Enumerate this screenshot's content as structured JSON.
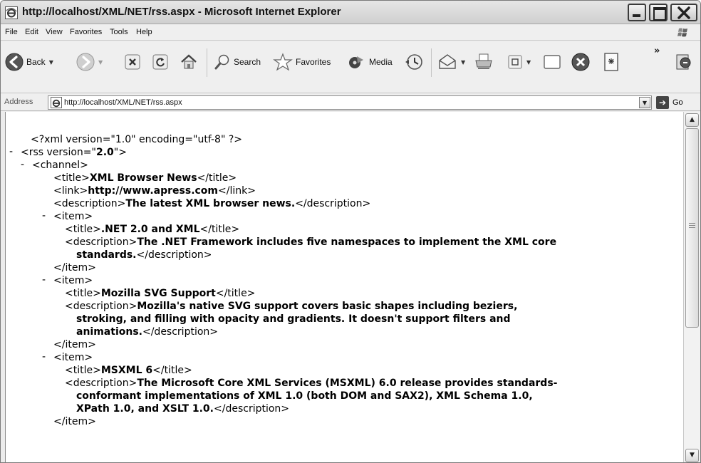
{
  "window": {
    "title": "http://localhost/XML/NET/rss.aspx - Microsoft Internet Explorer"
  },
  "menu": [
    "File",
    "Edit",
    "View",
    "Favorites",
    "Tools",
    "Help"
  ],
  "toolbar": {
    "back_label": "Back",
    "search_label": "Search",
    "favorites_label": "Favorites",
    "media_label": "Media",
    "more": "»"
  },
  "address": {
    "label": "Address",
    "url": "http://localhost/XML/NET/rss.aspx",
    "go_label": "Go"
  },
  "xml": {
    "declaration": "<?xml version=\"1.0\" encoding=\"utf-8\" ?>",
    "rss_open": "<rss version=\"",
    "rss_version": "2.0",
    "rss_close": "\">",
    "channel_open": "<channel>",
    "channel_title_open": "<title>",
    "channel_title": "XML Browser News",
    "channel_title_close": "</title>",
    "link_open": "<link>",
    "link": "http://www.apress.com",
    "link_close": "</link>",
    "desc_open": "<description>",
    "channel_description": "The latest XML browser news.",
    "desc_close": "</description>",
    "item_open": "<item>",
    "item_close": "</item>",
    "items": [
      {
        "title": ".NET 2.0 and XML",
        "description_lines": [
          "The .NET Framework includes five namespaces to implement the XML core",
          "standards."
        ]
      },
      {
        "title": "Mozilla SVG Support",
        "description_lines": [
          "Mozilla's native SVG support covers basic shapes including beziers,",
          "stroking, and filling with opacity and gradients. It doesn't support filters and",
          "animations."
        ]
      },
      {
        "title": "MSXML 6",
        "description_lines": [
          "The Microsoft Core XML Services (MSXML) 6.0 release provides standards-",
          "conformant implementations of XML 1.0 (both DOM and SAX2), XML Schema 1.0,",
          "XPath 1.0, and XSLT 1.0."
        ]
      }
    ],
    "collapse_marker": "-"
  }
}
